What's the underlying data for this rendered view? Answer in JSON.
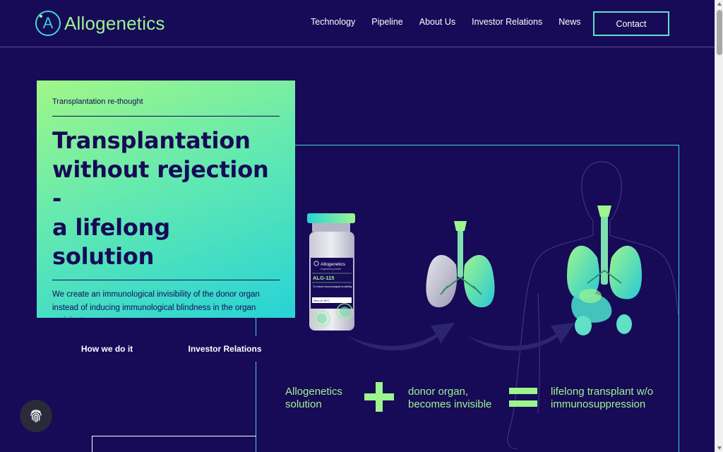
{
  "brand": {
    "name": "Allogenetics",
    "mark_letter": "A"
  },
  "nav": {
    "items": [
      "Technology",
      "Pipeline",
      "About Us",
      "Investor Relations",
      "News"
    ],
    "contact_label": "Contact"
  },
  "hero": {
    "eyebrow": "Transplantation re-thought",
    "title_lines": [
      "Transplantation",
      "without rejection -",
      "a lifelong solution"
    ],
    "description": "We create an immunological invisibility of the donor organ instead of inducing immunological blindness in the organ recipient.",
    "primary_button": "How we do it",
    "secondary_button": "Investor Relations"
  },
  "illustration": {
    "vial": {
      "brand": "Allogenetics",
      "tagline": "engineering health",
      "product": "ALG-115",
      "caption": "To induce immunological invisibility",
      "storage": "Store at -80°C"
    },
    "equation": {
      "left_label_lines": [
        "Allogenetics",
        "solution"
      ],
      "middle_label_lines": [
        "donor organ,",
        "becomes invisible"
      ],
      "right_label_lines": [
        "lifelong transplant w/o",
        "immunosuppression"
      ]
    }
  },
  "colors": {
    "background": "#170a57",
    "accent_green": "#9df58e",
    "accent_teal": "#3fdbd2",
    "card_gradient_start": "#a0f787",
    "card_gradient_end": "#27d3d6"
  },
  "icons": {
    "cookie_button": "fingerprint-icon",
    "plus": "plus-icon",
    "equals": "equals-icon"
  }
}
